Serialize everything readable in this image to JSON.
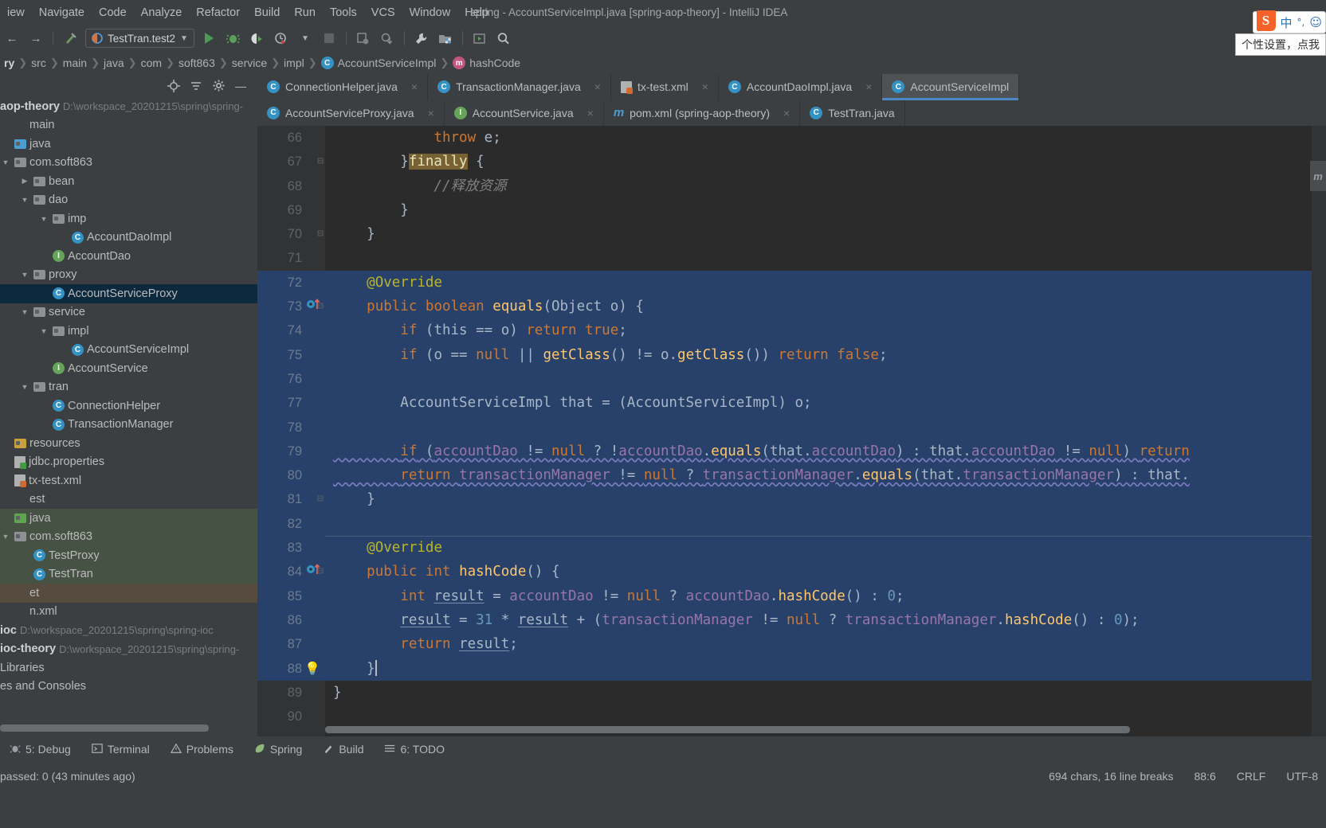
{
  "window": {
    "title": "spring - AccountServiceImpl.java [spring-aop-theory] - IntelliJ IDEA"
  },
  "menubar": {
    "items": [
      "iew",
      "Navigate",
      "Code",
      "Analyze",
      "Refactor",
      "Build",
      "Run",
      "Tools",
      "VCS",
      "Window",
      "Help"
    ]
  },
  "toolbar": {
    "run_config": "TestTran.test2",
    "icons": [
      "back-arrow",
      "forward-arrow",
      "build-hammer",
      "run",
      "debug",
      "run-coverage",
      "profile",
      "stop",
      "update-project",
      "commit",
      "wrench",
      "project-structure",
      "select-in",
      "search-everywhere"
    ]
  },
  "breadcrumb": {
    "items": [
      {
        "label": "ry",
        "icon": ""
      },
      {
        "label": "src",
        "icon": ""
      },
      {
        "label": "main",
        "icon": ""
      },
      {
        "label": "java",
        "icon": ""
      },
      {
        "label": "com",
        "icon": ""
      },
      {
        "label": "soft863",
        "icon": ""
      },
      {
        "label": "service",
        "icon": ""
      },
      {
        "label": "impl",
        "icon": ""
      },
      {
        "label": "AccountServiceImpl",
        "icon": "c"
      },
      {
        "label": "hashCode",
        "icon": "m"
      }
    ]
  },
  "sidebar": {
    "header_icons": [
      "locate-icon",
      "collapse-all-icon",
      "gear-icon",
      "hide-icon"
    ],
    "project_root": {
      "name": "aop-theory",
      "path": "D:\\workspace_20201215\\spring\\spring-"
    },
    "tree": [
      {
        "indent": 0,
        "arrow": "",
        "icon": "none",
        "label": "main",
        "state": "none"
      },
      {
        "indent": 0,
        "arrow": "",
        "icon": "blue",
        "label": "java",
        "state": "none"
      },
      {
        "indent": 0,
        "arrow": "▼",
        "icon": "folder",
        "label": "com.soft863",
        "state": "none"
      },
      {
        "indent": 1,
        "arrow": "▶",
        "icon": "folder",
        "label": "bean",
        "state": "none"
      },
      {
        "indent": 1,
        "arrow": "▼",
        "icon": "folder",
        "label": "dao",
        "state": "none"
      },
      {
        "indent": 2,
        "arrow": "▼",
        "icon": "folder",
        "label": "imp",
        "state": "none"
      },
      {
        "indent": 3,
        "arrow": "",
        "icon": "class",
        "label": "AccountDaoImpl",
        "state": "none"
      },
      {
        "indent": 2,
        "arrow": "",
        "icon": "iface",
        "label": "AccountDao",
        "state": "none"
      },
      {
        "indent": 1,
        "arrow": "▼",
        "icon": "folder",
        "label": "proxy",
        "state": "none"
      },
      {
        "indent": 2,
        "arrow": "",
        "icon": "class",
        "label": "AccountServiceProxy",
        "state": "sel"
      },
      {
        "indent": 1,
        "arrow": "▼",
        "icon": "folder",
        "label": "service",
        "state": "none"
      },
      {
        "indent": 2,
        "arrow": "▼",
        "icon": "folder",
        "label": "impl",
        "state": "none"
      },
      {
        "indent": 3,
        "arrow": "",
        "icon": "class",
        "label": "AccountServiceImpl",
        "state": "none"
      },
      {
        "indent": 2,
        "arrow": "",
        "icon": "iface",
        "label": "AccountService",
        "state": "none"
      },
      {
        "indent": 1,
        "arrow": "▼",
        "icon": "folder",
        "label": "tran",
        "state": "none"
      },
      {
        "indent": 2,
        "arrow": "",
        "icon": "class",
        "label": "ConnectionHelper",
        "state": "none"
      },
      {
        "indent": 2,
        "arrow": "",
        "icon": "class",
        "label": "TransactionManager",
        "state": "none"
      },
      {
        "indent": 0,
        "arrow": "",
        "icon": "res",
        "label": "resources",
        "state": "none"
      },
      {
        "indent": 0,
        "arrow": "",
        "icon": "prop",
        "label": "jdbc.properties",
        "state": "none"
      },
      {
        "indent": 0,
        "arrow": "",
        "icon": "xml",
        "label": "tx-test.xml",
        "state": "none"
      },
      {
        "indent": 0,
        "arrow": "",
        "icon": "none",
        "label": "est",
        "state": "none"
      },
      {
        "indent": 0,
        "arrow": "",
        "icon": "greenf",
        "label": "java",
        "state": "green"
      },
      {
        "indent": 0,
        "arrow": "▼",
        "icon": "folder",
        "label": "com.soft863",
        "state": "green"
      },
      {
        "indent": 1,
        "arrow": "",
        "icon": "test",
        "label": "TestProxy",
        "state": "green"
      },
      {
        "indent": 1,
        "arrow": "",
        "icon": "test",
        "label": "TestTran",
        "state": "green"
      },
      {
        "indent": 0,
        "arrow": "",
        "icon": "none",
        "label": "et",
        "state": "brown"
      },
      {
        "indent": 0,
        "arrow": "",
        "icon": "none",
        "label": "n.xml",
        "state": "none"
      }
    ],
    "modules": [
      {
        "name": "ioc",
        "path": "D:\\workspace_20201215\\spring\\spring-ioc"
      },
      {
        "name": "ioc-theory",
        "path": "D:\\workspace_20201215\\spring\\spring-"
      }
    ],
    "libraries_label": "Libraries",
    "scratches_label": "es and Consoles"
  },
  "editor": {
    "tab_rows": [
      [
        {
          "label": "ConnectionHelper.java",
          "icon": "c",
          "active": false,
          "close": "×"
        },
        {
          "label": "TransactionManager.java",
          "icon": "c",
          "active": false,
          "close": "×"
        },
        {
          "label": "tx-test.xml",
          "icon": "x",
          "active": false,
          "close": "×"
        },
        {
          "label": "AccountDaoImpl.java",
          "icon": "c",
          "active": false,
          "close": "×"
        },
        {
          "label": "AccountServiceImpl",
          "icon": "c",
          "active": true,
          "close": ""
        }
      ],
      [
        {
          "label": "AccountServiceProxy.java",
          "icon": "c",
          "active": false,
          "close": "×"
        },
        {
          "label": "AccountService.java",
          "icon": "i",
          "active": false,
          "close": "×"
        },
        {
          "label": "pom.xml (spring-aop-theory)",
          "icon": "m",
          "active": false,
          "close": "×"
        },
        {
          "label": "TestTran.java",
          "icon": "t",
          "active": false,
          "close": ""
        }
      ]
    ],
    "right_tool_tab": "Maven",
    "lines": [
      {
        "n": 66,
        "fold": "",
        "gutter": "",
        "hl": false
      },
      {
        "n": 67,
        "fold": "⊟",
        "gutter": "",
        "hl": false
      },
      {
        "n": 68,
        "fold": "",
        "gutter": "",
        "hl": false
      },
      {
        "n": 69,
        "fold": "",
        "gutter": "",
        "hl": false
      },
      {
        "n": 70,
        "fold": "⊟",
        "gutter": "",
        "hl": false
      },
      {
        "n": 71,
        "fold": "",
        "gutter": "",
        "hl": false
      },
      {
        "n": 72,
        "fold": "",
        "gutter": "",
        "hl": true
      },
      {
        "n": 73,
        "fold": "⊟",
        "gutter": "override",
        "hl": true
      },
      {
        "n": 74,
        "fold": "",
        "gutter": "",
        "hl": true
      },
      {
        "n": 75,
        "fold": "",
        "gutter": "",
        "hl": true
      },
      {
        "n": 76,
        "fold": "",
        "gutter": "",
        "hl": true
      },
      {
        "n": 77,
        "fold": "",
        "gutter": "",
        "hl": true
      },
      {
        "n": 78,
        "fold": "",
        "gutter": "",
        "hl": true
      },
      {
        "n": 79,
        "fold": "",
        "gutter": "",
        "hl": true
      },
      {
        "n": 80,
        "fold": "",
        "gutter": "",
        "hl": true
      },
      {
        "n": 81,
        "fold": "⊟",
        "gutter": "",
        "hl": true
      },
      {
        "n": 82,
        "fold": "",
        "gutter": "",
        "hl": true
      },
      {
        "n": 83,
        "fold": "",
        "gutter": "",
        "hl": true
      },
      {
        "n": 84,
        "fold": "⊟",
        "gutter": "override",
        "hl": true
      },
      {
        "n": 85,
        "fold": "",
        "gutter": "",
        "hl": true
      },
      {
        "n": 86,
        "fold": "",
        "gutter": "",
        "hl": true
      },
      {
        "n": 87,
        "fold": "",
        "gutter": "",
        "hl": true
      },
      {
        "n": 88,
        "fold": "",
        "gutter": "bulb",
        "hl": true
      },
      {
        "n": 89,
        "fold": "",
        "gutter": "",
        "hl": false
      },
      {
        "n": 90,
        "fold": "",
        "gutter": "",
        "hl": false
      }
    ],
    "source_text": [
      "            throw e;",
      "        }finally {",
      "            //释放资源",
      "        }",
      "    }",
      "",
      "    @Override",
      "    public boolean equals(Object o) {",
      "        if (this == o) return true;",
      "        if (o == null || getClass() != o.getClass()) return false;",
      "",
      "        AccountServiceImpl that = (AccountServiceImpl) o;",
      "",
      "        if (accountDao != null ? !accountDao.equals(that.accountDao) : that.accountDao != null) return",
      "        return transactionManager != null ? transactionManager.equals(that.transactionManager) : that.",
      "    }",
      "",
      "    @Override",
      "    public int hashCode() {",
      "        int result = accountDao != null ? accountDao.hashCode() : 0;",
      "        result = 31 * result + (transactionManager != null ? transactionManager.hashCode() : 0);",
      "        return result;",
      "    }",
      "}",
      ""
    ]
  },
  "toolwindows": {
    "items": [
      {
        "label": "5: Debug",
        "icon": "debug-icon",
        "mnemonic": "5"
      },
      {
        "label": "Terminal",
        "icon": "terminal-icon",
        "mnemonic": ""
      },
      {
        "label": "Problems",
        "icon": "warning-icon",
        "mnemonic": ""
      },
      {
        "label": "Spring",
        "icon": "leaf-icon",
        "mnemonic": ""
      },
      {
        "label": "Build",
        "icon": "hammer-icon",
        "mnemonic": ""
      },
      {
        "label": "6: TODO",
        "icon": "list-icon",
        "mnemonic": "6"
      }
    ]
  },
  "status": {
    "left": "passed: 0 (43 minutes ago)",
    "chars": "694 chars, 16 line breaks",
    "caret": "88:6",
    "line_ending": "CRLF",
    "encoding": "UTF-8"
  },
  "ime": {
    "logo": "S",
    "mode": "中",
    "glyphs": "°,",
    "smiley": "☺",
    "tooltip": "个性设置，点我"
  },
  "colors": {
    "accent": "#4a88c7",
    "selection": "#27416a",
    "tree_selection": "#0d293e",
    "run_green": "#499c54",
    "editor_bg": "#2b2b2b",
    "chrome_bg": "#3c3f41"
  }
}
